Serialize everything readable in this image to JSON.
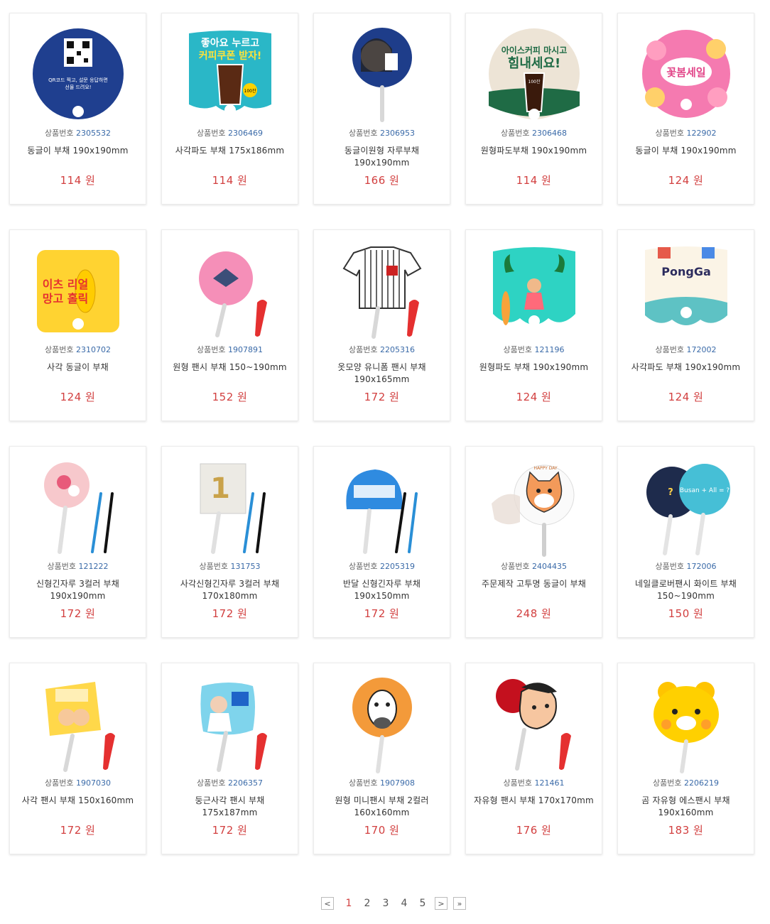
{
  "code_label": "상품번호",
  "currency": "원",
  "products": [
    {
      "code": "2305532",
      "name": "동글이 부채 190x190mm",
      "price": "114",
      "art": "qr-round"
    },
    {
      "code": "2306469",
      "name": "사각파도 부채 175x186mm",
      "price": "114",
      "art": "coffee-wave"
    },
    {
      "code": "2306953",
      "name": "동글이원형 자루부채 190x190mm",
      "price": "166",
      "art": "round-handle"
    },
    {
      "code": "2306468",
      "name": "원형파도부채 190x190mm",
      "price": "114",
      "art": "iced-coffee"
    },
    {
      "code": "122902",
      "name": "동글이 부채 190x190mm",
      "price": "124",
      "art": "pink-flower"
    },
    {
      "code": "2310702",
      "name": "사각 동글이 부채",
      "price": "124",
      "art": "mango"
    },
    {
      "code": "1907891",
      "name": "원형 팬시 부채 150~190mm",
      "price": "152",
      "art": "pink-fancy"
    },
    {
      "code": "2205316",
      "name": "옷모양 유니폼 팬시 부채 190x165mm",
      "price": "172",
      "art": "uniform"
    },
    {
      "code": "121196",
      "name": "원형파도 부채 190x190mm",
      "price": "124",
      "art": "tropical"
    },
    {
      "code": "172002",
      "name": "사각파도 부채 190x190mm",
      "price": "124",
      "art": "pongga"
    },
    {
      "code": "121222",
      "name": "신형긴자루 3컬러 부채 190x190mm",
      "price": "172",
      "art": "candy-round"
    },
    {
      "code": "131753",
      "name": "사각신형긴자루 3컬러 부채 170x180mm",
      "price": "172",
      "art": "square-three"
    },
    {
      "code": "2205319",
      "name": "반달 신형긴자루 부채 190x150mm",
      "price": "172",
      "art": "halfmoon"
    },
    {
      "code": "2404435",
      "name": "주문제작 고투명 동글이 부채",
      "price": "248",
      "art": "clear-fox"
    },
    {
      "code": "172006",
      "name": "네일클로버팬시 화이트 부채 150~190mm",
      "price": "150",
      "art": "nail-clover"
    },
    {
      "code": "1907030",
      "name": "사각 팬시 부채 150x160mm",
      "price": "172",
      "art": "square-fancy"
    },
    {
      "code": "2206357",
      "name": "둥근사각 팬시 부채 175x187mm",
      "price": "172",
      "art": "rounded-square"
    },
    {
      "code": "1907908",
      "name": "원형 미니팬시 부채 2컬러 160x160mm",
      "price": "170",
      "art": "zebra"
    },
    {
      "code": "121461",
      "name": "자유형 팬시 부채 170x170mm",
      "price": "176",
      "art": "freeform"
    },
    {
      "code": "2206219",
      "name": "곰 자유형 에스팬시 부채 190x160mm",
      "price": "183",
      "art": "bear"
    }
  ],
  "art_text": {
    "qr-round": [
      "QR코드 찍고, 설문 응답하면",
      "선물 드려요!"
    ],
    "coffee-wave": [
      "좋아요 누르고",
      "커피쿠폰 받자!",
      "100잔"
    ],
    "iced-coffee": [
      "아이스커피 마시고",
      "힘내세요!",
      "100잔"
    ],
    "pink-flower": [
      "꽃봄세일"
    ],
    "mango": [
      "이츠 리얼",
      "망고 홀릭"
    ],
    "pongga": [
      "PongGa"
    ],
    "clear-fox": [
      "HAPPY DAY"
    ],
    "nail-clover": [
      "Busan + All = ?"
    ]
  },
  "pagination": {
    "prev_label": "<",
    "next_label": ">",
    "last_label": "»",
    "pages": [
      "1",
      "2",
      "3",
      "4",
      "5"
    ],
    "current": "1"
  },
  "colors": {
    "price": "#d23f3f",
    "code_number": "#3a6aa8"
  }
}
